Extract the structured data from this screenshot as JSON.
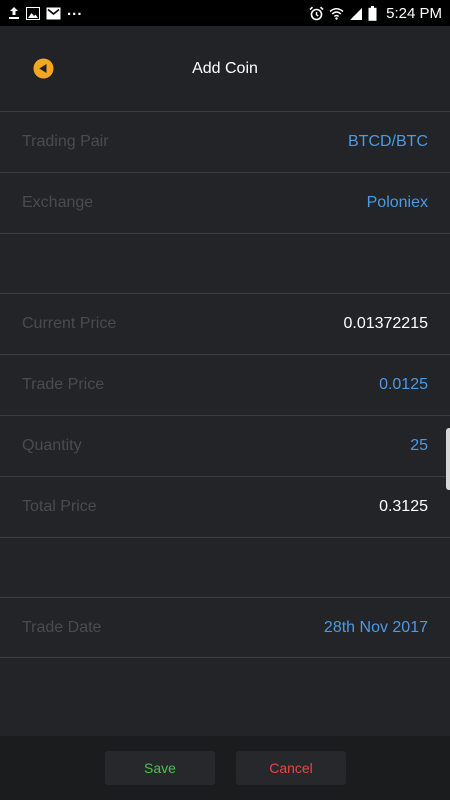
{
  "status_bar": {
    "time": "5:24 PM",
    "more_indicator": "...",
    "left_icons": [
      "upload-icon",
      "image-icon",
      "gmail-icon"
    ],
    "right_icons": [
      "alarm-icon",
      "wifi-icon",
      "signal-icon",
      "battery-icon"
    ]
  },
  "header": {
    "title": "Add Coin",
    "back_icon": "back-arrow-icon",
    "accent_color": "#F5A623"
  },
  "form": {
    "trading_pair": {
      "label": "Trading Pair",
      "value": "BTCD/BTC"
    },
    "exchange": {
      "label": "Exchange",
      "value": "Poloniex"
    },
    "current_price": {
      "label": "Current Price",
      "value": "0.01372215"
    },
    "trade_price": {
      "label": "Trade Price",
      "value": "0.0125"
    },
    "quantity": {
      "label": "Quantity",
      "value": "25"
    },
    "total_price": {
      "label": "Total Price",
      "value": "0.3125"
    },
    "trade_date": {
      "label": "Trade Date",
      "value": "28th Nov 2017"
    }
  },
  "footer": {
    "save_label": "Save",
    "cancel_label": "Cancel"
  },
  "colors": {
    "background": "#232427",
    "link_blue": "#4A9AE6",
    "save_green": "#4FBF4F",
    "cancel_red": "#E9463F",
    "label_gray": "#4A4B50"
  }
}
